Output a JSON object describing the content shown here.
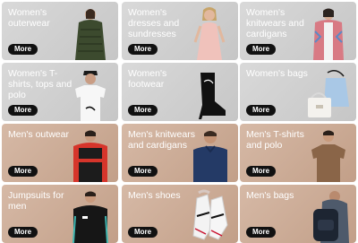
{
  "tiles": [
    {
      "title": "Women's outerwear",
      "button": "More",
      "image": "woman-green-puffer-jacket"
    },
    {
      "title": "Women's dresses and sundresses",
      "button": "More",
      "image": "woman-pink-dress"
    },
    {
      "title": "Women's knitwears and cardigans",
      "button": "More",
      "image": "woman-patterned-cardigan"
    },
    {
      "title": "Women's T-shirts, tops and polo",
      "button": "More",
      "image": "woman-white-tshirt"
    },
    {
      "title": "Women's footwear",
      "button": "More",
      "image": "black-sock-boot"
    },
    {
      "title": "Women's bags",
      "button": "More",
      "image": "white-and-blue-handbags"
    },
    {
      "title": "Men's outwear",
      "button": "More",
      "image": "man-red-black-jacket"
    },
    {
      "title": "Men's knitwears and cardigans",
      "button": "More",
      "image": "man-navy-sweater"
    },
    {
      "title": "Men's T-shirts and polo",
      "button": "More",
      "image": "man-brown-tshirt"
    },
    {
      "title": "Jumpsuits for men",
      "button": "More",
      "image": "man-black-tracksuit"
    },
    {
      "title": "Men's shoes",
      "button": "More",
      "image": "white-sneakers"
    },
    {
      "title": "Men's bags",
      "button": "More",
      "image": "man-with-backpack"
    }
  ]
}
